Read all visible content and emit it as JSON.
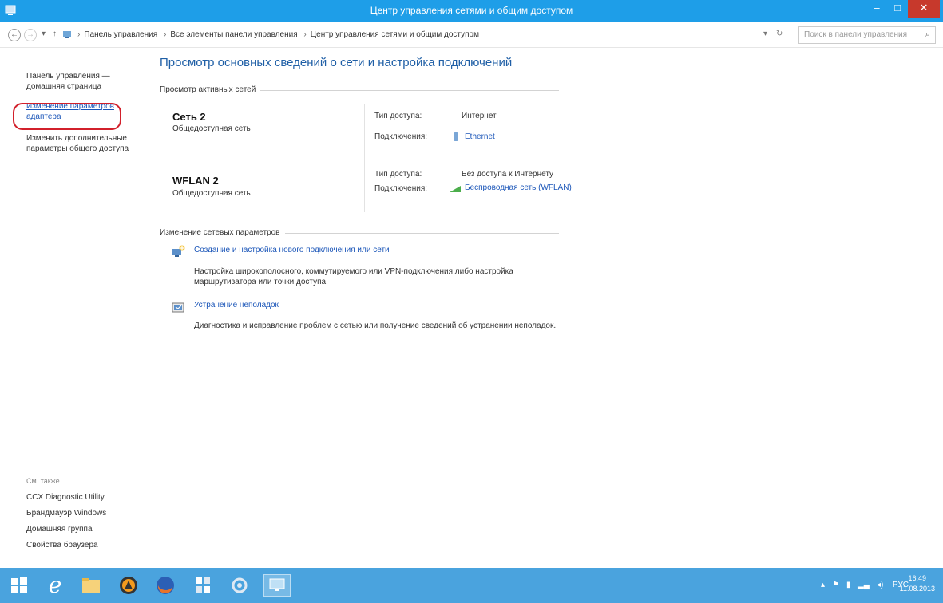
{
  "window": {
    "title": "Центр управления сетями и общим доступом"
  },
  "address": {
    "crumbs": [
      "Панель управления",
      "Все элементы панели управления",
      "Центр управления сетями и общим доступом"
    ],
    "search_placeholder": "Поиск в панели управления"
  },
  "sidebar": {
    "home": "Панель управления — домашняя страница",
    "adapter": "Изменение параметров адаптера",
    "sharing": "Изменить дополнительные параметры общего доступа",
    "see_also": "См. также",
    "links": [
      "CCX Diagnostic Utility",
      "Брандмауэр Windows",
      "Домашняя группа",
      "Свойства браузера"
    ]
  },
  "main": {
    "title": "Просмотр основных сведений о сети и настройка подключений",
    "active_networks_label": "Просмотр активных сетей",
    "networks": [
      {
        "name": "Сеть 2",
        "type": "Общедоступная сеть",
        "access_label": "Тип доступа:",
        "access_value": "Интернет",
        "conn_label": "Подключения:",
        "conn_value": "Ethernet"
      },
      {
        "name": "WFLAN 2",
        "type": "Общедоступная сеть",
        "access_label": "Тип доступа:",
        "access_value": "Без доступа к Интернету",
        "conn_label": "Подключения:",
        "conn_value": "Беспроводная сеть (WFLAN)"
      }
    ],
    "change_settings_label": "Изменение сетевых параметров",
    "tasks": [
      {
        "link": "Создание и настройка нового подключения или сети",
        "desc": "Настройка широкополосного, коммутируемого или VPN-подключения либо настройка маршрутизатора или точки доступа."
      },
      {
        "link": "Устранение неполадок",
        "desc": "Диагностика и исправление проблем с сетью или получение сведений об устранении неполадок."
      }
    ]
  },
  "taskbar": {
    "lang": "РУС",
    "time": "16:49",
    "date": "11.08.2013"
  }
}
